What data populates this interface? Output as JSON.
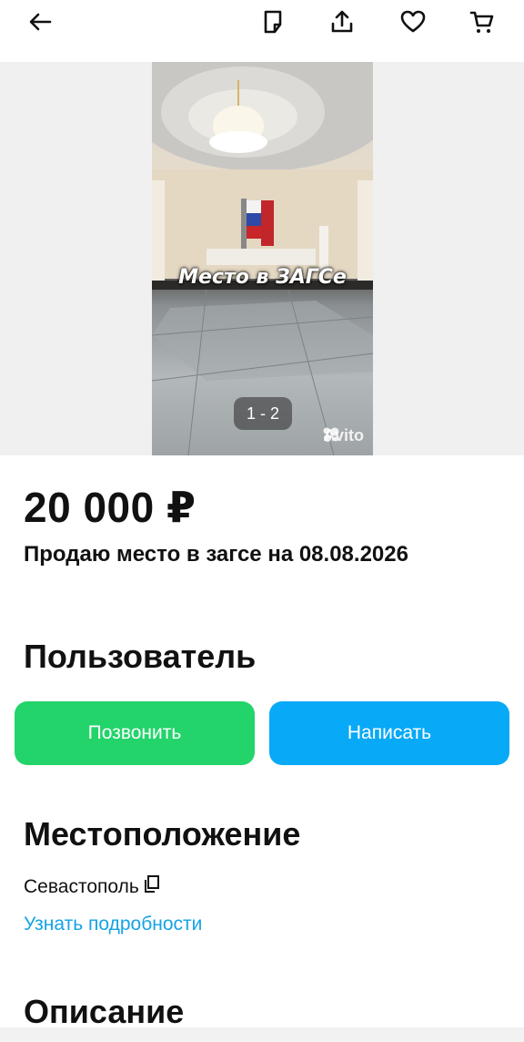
{
  "header": {
    "back_icon": "arrow-left-icon",
    "actions": [
      "note-icon",
      "share-icon",
      "heart-icon",
      "cart-icon"
    ]
  },
  "gallery": {
    "overlay_text": "Место в ЗАГСе",
    "counter": "1 - 2",
    "watermark": "Avito"
  },
  "listing": {
    "price": "20 000 ₽",
    "title": "Продаю место в загсе на 08.08.2026"
  },
  "seller": {
    "heading": "Пользователь",
    "call_label": "Позвонить",
    "message_label": "Написать"
  },
  "location": {
    "heading": "Местоположение",
    "city": "Севастополь",
    "details_link": "Узнать подробности"
  },
  "description": {
    "heading": "Описание"
  },
  "colors": {
    "call_button": "#22d46a",
    "message_button": "#08a9f7",
    "link": "#14a3e6"
  }
}
